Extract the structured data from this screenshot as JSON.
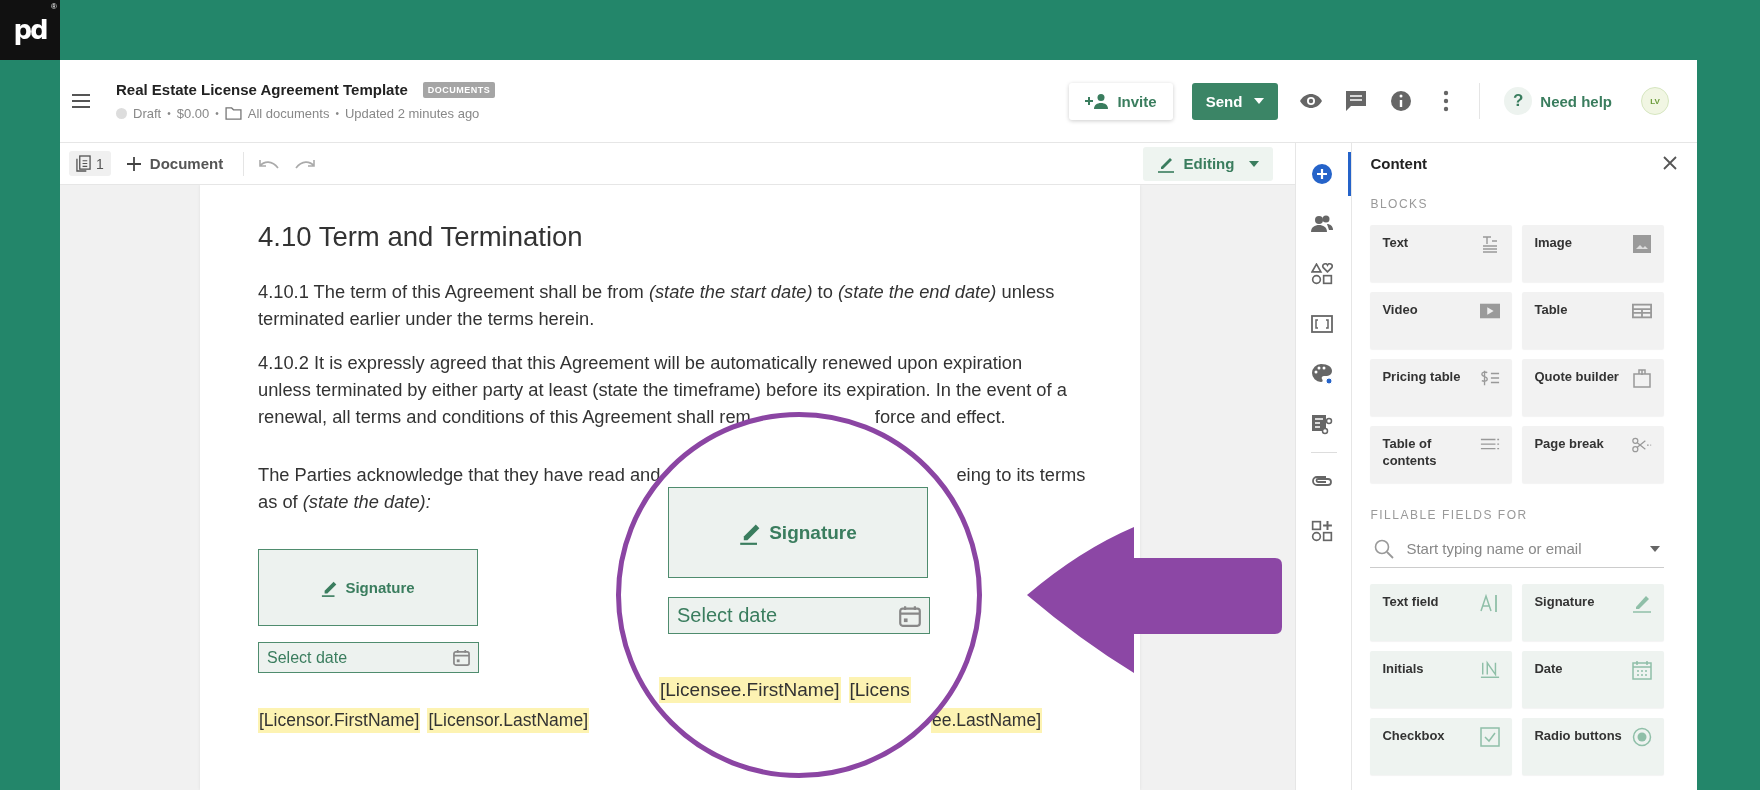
{
  "logo": {
    "text": "pd",
    "mark": "®"
  },
  "header": {
    "title": "Real Estate License Agreement Template",
    "badge": "DOCUMENTS",
    "meta": [
      {
        "kind": "status",
        "text": "Draft"
      },
      {
        "kind": "plain",
        "text": "$0.00"
      },
      {
        "kind": "folder",
        "text": "All documents"
      },
      {
        "kind": "plain",
        "text": "Updated 2 minutes ago"
      }
    ],
    "separators": [
      "•",
      "•",
      "•"
    ],
    "invite": "Invite",
    "send": "Send",
    "help_mark": "?",
    "help": "Need help",
    "avatar": "LV"
  },
  "toolbar": {
    "page_count": "1",
    "add_document": "Document",
    "mode": "Editing"
  },
  "document": {
    "heading": "4.10 Term and Termination",
    "paragraphs": [
      {
        "lines": [
          {
            "left": "4.10.1 The term of this Agreement shall be from *(state the start date)* to *(state the end date)* unless"
          },
          {
            "left": "terminated earlier under the terms herein."
          }
        ]
      },
      {
        "lines": [
          {
            "left": "4.10.2 It is expressly agreed that this Agreement will be automatically renewed upon expiration"
          },
          {
            "left": "unless terminated by either party at least (state the timeframe) before its expiration. In the event of a"
          },
          {
            "left": "renewal, all terms and conditions of this Agreement shall rem",
            "right": "force and effect."
          }
        ]
      },
      {
        "lines": [
          {
            "left": "The Parties acknowledge that they have read and",
            "right": "eing to its terms"
          },
          {
            "left": "as of *(state the date):*"
          }
        ]
      }
    ],
    "signature": "Signature",
    "date_placeholder": "Select date",
    "merge_fields": [
      "[Licensor.FirstName]",
      "[Licensor.LastName]"
    ],
    "right_fragment": "ee.LastName]"
  },
  "magnifier": {
    "signature": "Signature",
    "date_placeholder": "Select date",
    "merge_fields": [
      "[Licensee.FirstName]",
      "[Licens"
    ]
  },
  "rail": [
    {
      "items": [
        {
          "kind": "add",
          "selected": true
        },
        {
          "kind": "people",
          "selected": false
        },
        {
          "kind": "shapes",
          "selected": false
        },
        {
          "kind": "embed",
          "selected": false
        },
        {
          "kind": "palette",
          "selected": false
        },
        {
          "kind": "workflow",
          "selected": false
        }
      ]
    },
    {
      "items": [
        {
          "kind": "attachment",
          "selected": false
        },
        {
          "kind": "widgets",
          "selected": false
        }
      ]
    }
  ],
  "panel": {
    "title": "Content",
    "blocks": {
      "title": "BLOCKS",
      "items": [
        {
          "label": "Text",
          "kind": "text"
        },
        {
          "label": "Image",
          "kind": "image"
        },
        {
          "label": "Video",
          "kind": "video"
        },
        {
          "label": "Table",
          "kind": "table"
        },
        {
          "label": "Pricing table",
          "kind": "pricing"
        },
        {
          "label": "Quote builder",
          "kind": "quote"
        },
        {
          "label": "Table of contents",
          "kind": "toc"
        },
        {
          "label": "Page break",
          "kind": "pagebreak"
        }
      ]
    },
    "fields": {
      "title": "FILLABLE FIELDS FOR",
      "search_placeholder": "Start typing name or email",
      "items": [
        {
          "label": "Text field",
          "kind": "textfield"
        },
        {
          "label": "Signature",
          "kind": "signature"
        },
        {
          "label": "Initials",
          "kind": "initials"
        },
        {
          "label": "Date",
          "kind": "date"
        },
        {
          "label": "Checkbox",
          "kind": "checkbox"
        },
        {
          "label": "Radio buttons",
          "kind": "radio"
        }
      ]
    }
  }
}
